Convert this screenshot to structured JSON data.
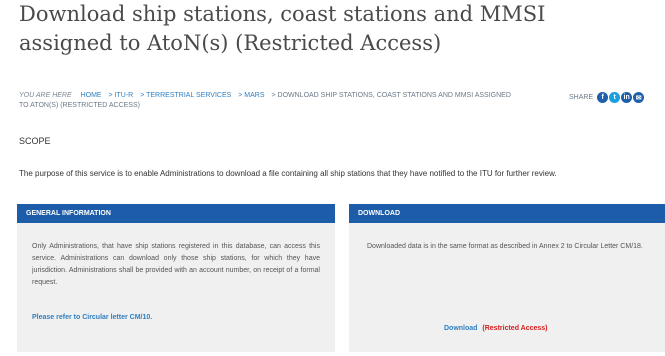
{
  "page": {
    "title": "Download ship stations, coast stations and MMSI assigned to AtoN(s) (Restricted Access)"
  },
  "breadcrumb": {
    "here": "YOU ARE HERE",
    "items": [
      "HOME",
      "> ITU-R",
      "> TERRESTRIAL SERVICES",
      "> MARS"
    ],
    "current": "> DOWNLOAD SHIP STATIONS, COAST STATIONS AND MMSI ASSIGNED TO ATON(S) (RESTRICTED ACCESS)"
  },
  "share": {
    "label": "SHARE",
    "icons": [
      "facebook-icon",
      "twitter-icon",
      "linkedin-icon",
      "email-icon"
    ],
    "colors": [
      "#1d5ca8",
      "#1a9fe0",
      "#1d5ca8",
      "#1d5ca8"
    ]
  },
  "scope": {
    "heading": "SCOPE",
    "text": "The purpose of this service is to enable Administrations to download a file containing all ship stations that they have notified to the ITU for further review."
  },
  "general": {
    "heading": "GENERAL INFORMATION",
    "body": "Only Administrations, that have ship stations registered in this database, can access this service. Administrations can download only those ship stations, for which they have jurisdiction. Administrations shall be provided with an account number, on receipt of a formal request.",
    "link": "Please refer to Circular letter CM/10."
  },
  "download": {
    "heading": "DOWNLOAD",
    "body": "Downloaded data is in the same format as described in Annex 2 to Circular Letter CM/18.",
    "link": "Download",
    "restricted": "(Restricted Access)"
  },
  "colors": {
    "panel_header": "#1d5ca8",
    "link": "#2f7fc1",
    "restricted": "#d32020"
  }
}
